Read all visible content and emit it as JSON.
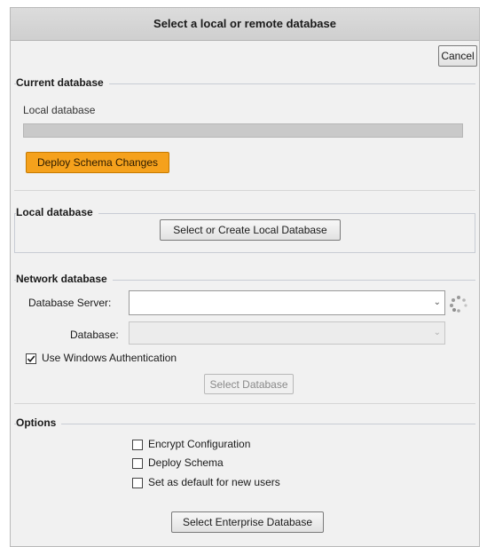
{
  "dialog": {
    "title": "Select a local or remote database",
    "cancel_label": "Cancel"
  },
  "current_database": {
    "group_title": "Current database",
    "label": "Local database",
    "deploy_label": "Deploy Schema Changes",
    "deploy_color": "#f5a11c"
  },
  "local_database": {
    "group_title": "Local database",
    "select_create_label": "Select or Create Local Database"
  },
  "network_database": {
    "group_title": "Network database",
    "server_label": "Database Server:",
    "server_value": "",
    "database_label": "Database:",
    "database_value": "",
    "windows_auth_label": "Use Windows Authentication",
    "windows_auth_checked": true,
    "select_database_label": "Select Database",
    "loading_icon": "spinner-icon"
  },
  "options": {
    "group_title": "Options",
    "items": [
      {
        "label": "Encrypt Configuration",
        "checked": false
      },
      {
        "label": "Deploy Schema",
        "checked": false
      },
      {
        "label": "Set as default for new users",
        "checked": false
      }
    ],
    "enterprise_label": "Select Enterprise Database"
  }
}
